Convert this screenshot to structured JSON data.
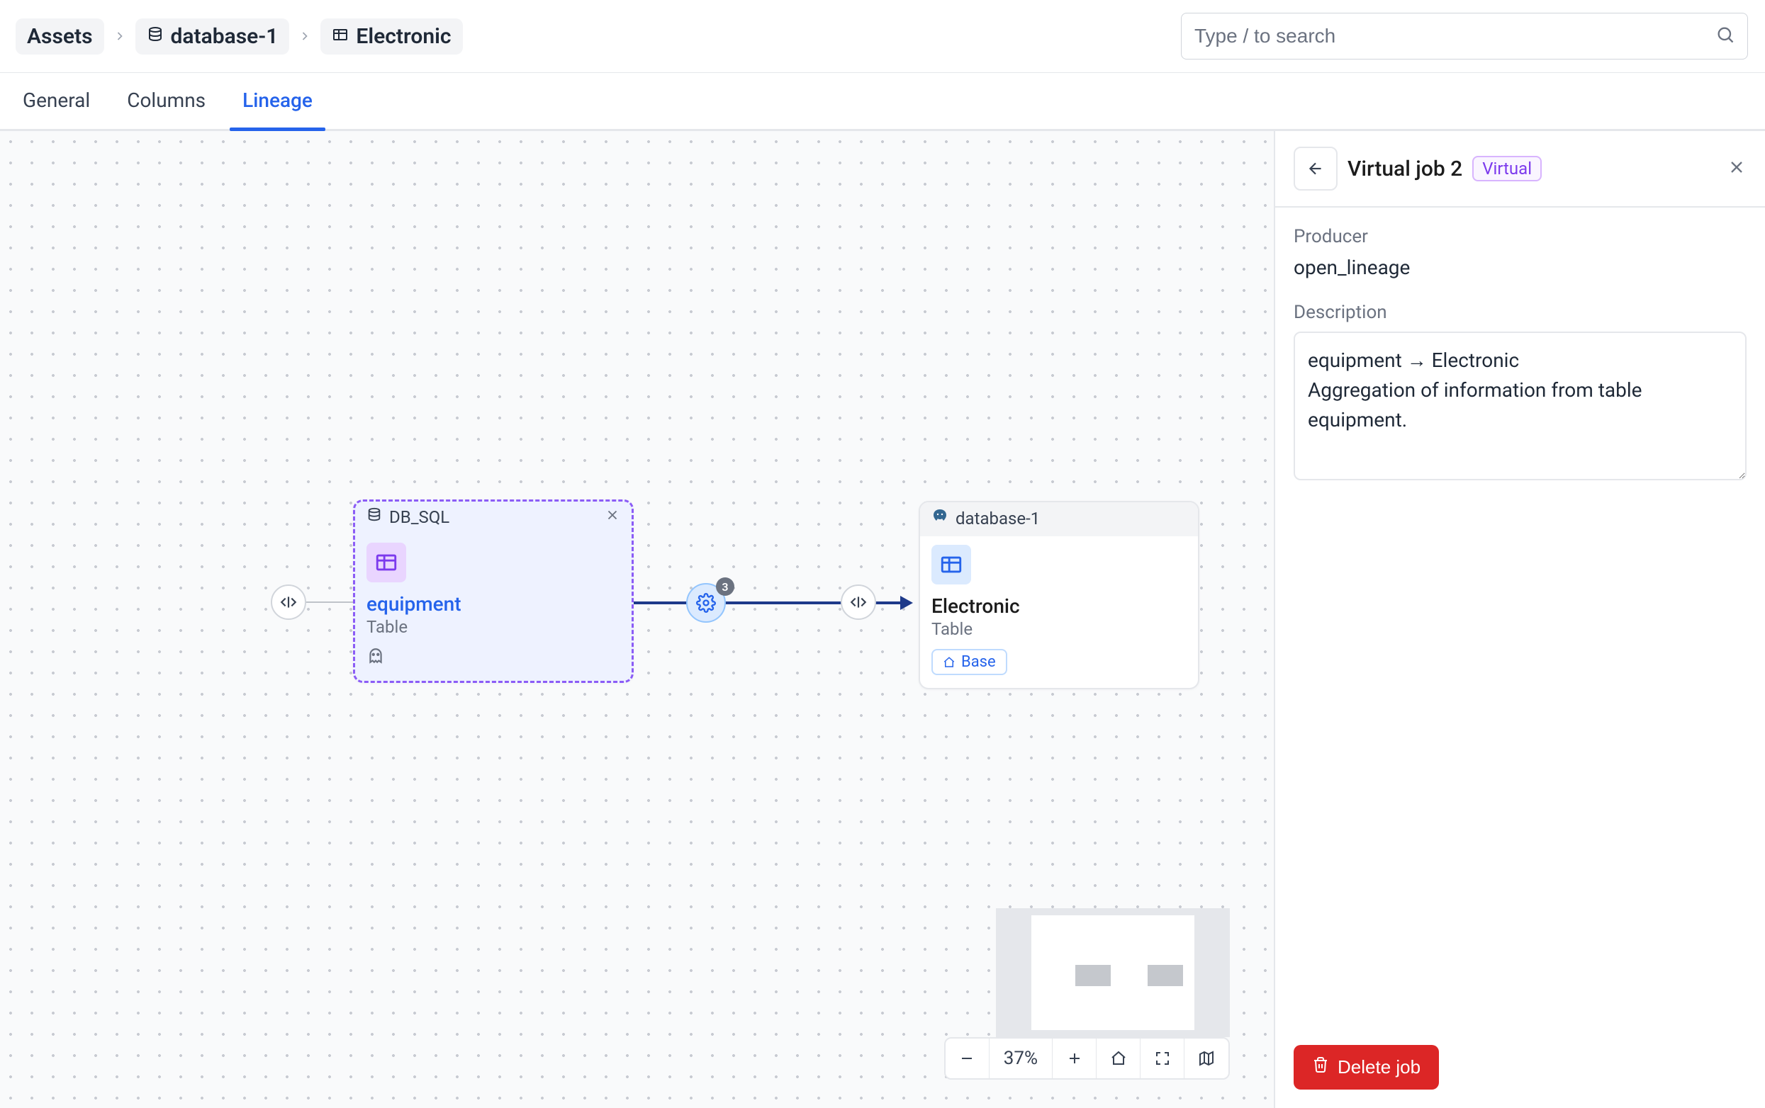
{
  "breadcrumbs": {
    "root": "Assets",
    "db": "database-1",
    "table": "Electronic"
  },
  "search": {
    "placeholder": "Type / to search"
  },
  "tabs": {
    "general": "General",
    "columns": "Columns",
    "lineage": "Lineage"
  },
  "nodes": {
    "equipment": {
      "header_label": "DB_SQL",
      "title": "equipment",
      "subtitle": "Table"
    },
    "electronic": {
      "header_label": "database-1",
      "title": "Electronic",
      "subtitle": "Table",
      "base_label": "Base"
    }
  },
  "job": {
    "count_badge": "3"
  },
  "zoom": {
    "level": "37%"
  },
  "panel": {
    "title": "Virtual job 2",
    "virtual_badge": "Virtual",
    "producer_label": "Producer",
    "producer_value": "open_lineage",
    "description_label": "Description",
    "description_value": "equipment → Electronic\nAggregation of information from table equipment.",
    "delete_label": "Delete job"
  }
}
